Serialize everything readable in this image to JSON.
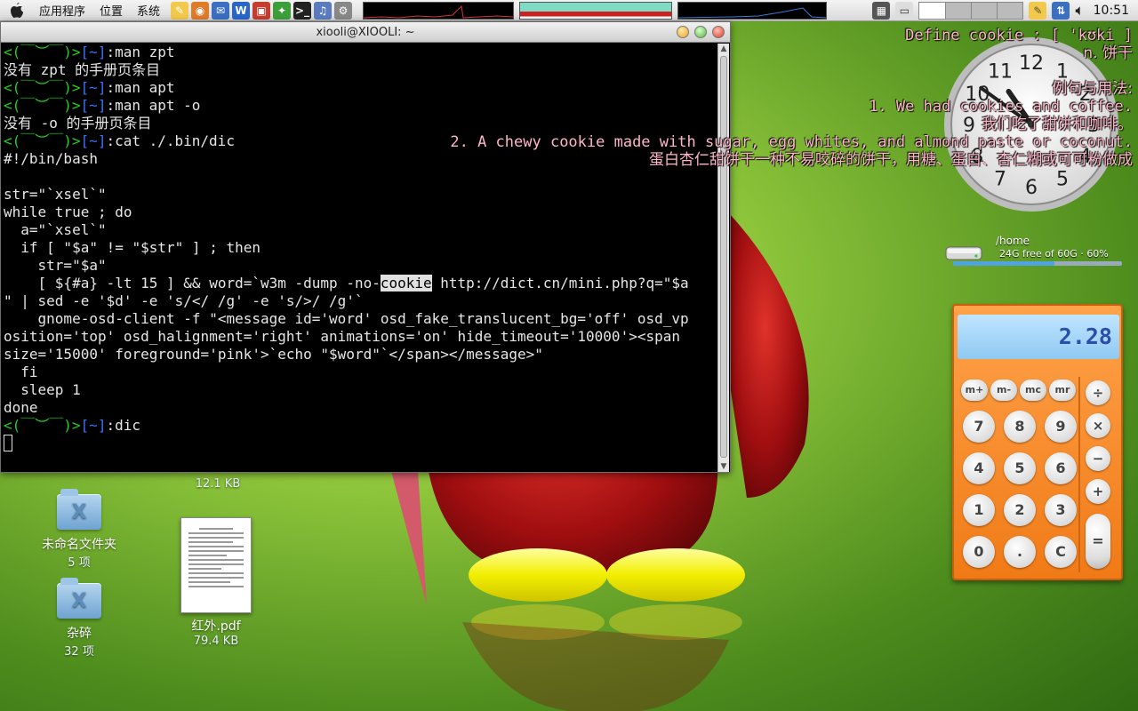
{
  "top_panel": {
    "menus": [
      "应用程序",
      "位置",
      "系统"
    ],
    "clock": "10:51"
  },
  "terminal": {
    "title": "xiooli@XIOOLI: ~",
    "prompt_face": "<(￣︶￣)>",
    "prompt_path": "[~]",
    "lines": [
      {
        "type": "prompt",
        "cmd": ":man zpt"
      },
      {
        "type": "out",
        "text": "没有 zpt 的手册页条目"
      },
      {
        "type": "prompt",
        "cmd": ":man apt"
      },
      {
        "type": "prompt",
        "cmd": ":man apt -o"
      },
      {
        "type": "out",
        "text": "没有 -o 的手册页条目"
      },
      {
        "type": "prompt",
        "cmd": ":cat ./.bin/dic"
      },
      {
        "type": "out",
        "text": "#!/bin/bash"
      },
      {
        "type": "out",
        "text": ""
      },
      {
        "type": "out",
        "text": "str=\"`xsel`\""
      },
      {
        "type": "out",
        "text": "while true ; do"
      },
      {
        "type": "out",
        "text": "  a=\"`xsel`\""
      },
      {
        "type": "out",
        "text": "  if [ \"$a\" != \"$str\" ] ; then"
      },
      {
        "type": "out",
        "text": "    str=\"$a\""
      },
      {
        "type": "hl",
        "pre": "    [ ${#a} -lt 15 ] && word=`w3m -dump -no-",
        "hl": "cookie",
        "post": " http://dict.cn/mini.php?q=\"$a"
      },
      {
        "type": "out",
        "text": "\" | sed -e '$d' -e 's/</ /g' -e 's/>/ /g'`"
      },
      {
        "type": "out",
        "text": "    gnome-osd-client -f \"<message id='word' osd_fake_translucent_bg='off' osd_vp"
      },
      {
        "type": "out",
        "text": "osition='top' osd_halignment='right' animations='on' hide_timeout='10000'><span"
      },
      {
        "type": "out",
        "text": "size='15000' foreground='pink'>`echo \"$word\"`</span></message>\""
      },
      {
        "type": "out",
        "text": "  fi"
      },
      {
        "type": "out",
        "text": "  sleep 1"
      },
      {
        "type": "out",
        "text": "done"
      },
      {
        "type": "prompt",
        "cmd": ":dic"
      },
      {
        "type": "cursor"
      }
    ]
  },
  "osd": {
    "lines": [
      "Define cookie : [ 'kʊki ]",
      "n. 饼干",
      "例句与用法:",
      "1. We had cookies and coffee.",
      "我们吃了甜饼和咖啡。",
      "2. A chewy cookie made with sugar, egg whites, and almond paste or coconut.",
      "蛋白杏仁甜饼干一种不易咬碎的饼干，用糖、蛋白、杏仁糊或可可粉做成"
    ]
  },
  "desktop": {
    "stray_size": "12.1 KB",
    "icons": [
      {
        "name": "未命名文件夹",
        "sub": "5 项"
      },
      {
        "name": "杂碎",
        "sub": "32 项"
      },
      {
        "name": "红外.pdf",
        "sub": "79.4 KB"
      }
    ]
  },
  "disk": {
    "label": "/home",
    "info": "24G free of 60G · 60%",
    "used_fraction": 0.6
  },
  "calculator": {
    "display": "2.28",
    "memory_keys": [
      "m+",
      "m-",
      "mc",
      "mr"
    ],
    "digits": [
      "7",
      "8",
      "9",
      "4",
      "5",
      "6",
      "1",
      "2",
      "3",
      "0",
      ".",
      "C"
    ],
    "ops": [
      "÷",
      "×",
      "−",
      "+",
      "="
    ]
  },
  "clock_widget": {
    "numerals": [
      "12",
      "1",
      "2",
      "3",
      "4",
      "5",
      "6",
      "7",
      "8",
      "9",
      "10",
      "11"
    ],
    "hour": 10,
    "minute": 51
  }
}
